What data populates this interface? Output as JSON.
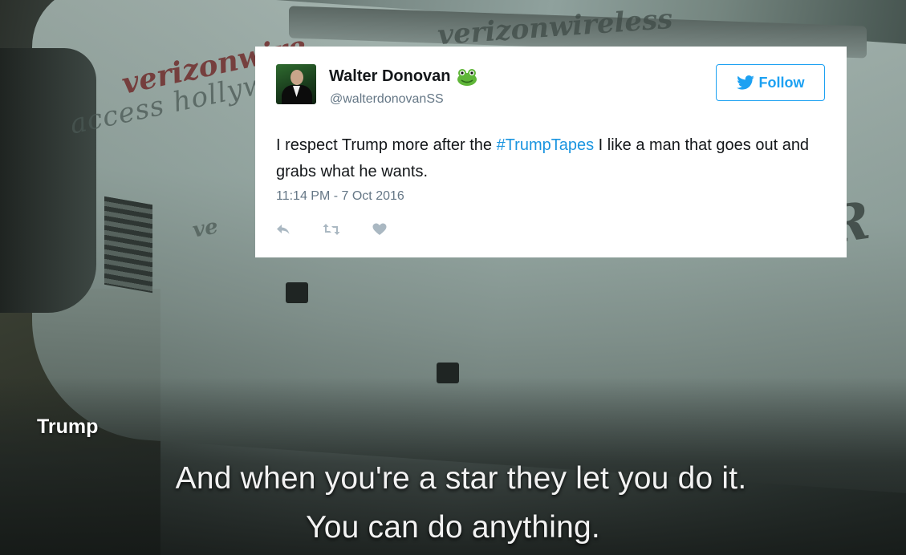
{
  "video": {
    "scene_texts": [
      "verizonwire",
      "access hollyw",
      "verizonwireless",
      "UR",
      "ve"
    ],
    "speaker": "Trump",
    "caption_line_1": "And when you're a star they let you do it.",
    "caption_line_2": "You can do anything."
  },
  "tweet": {
    "author_name": "Walter Donovan",
    "author_handle": "@walterdonovanSS",
    "follow_label": "Follow",
    "text_before": "I respect Trump more after the ",
    "hashtag": "#TrumpTapes",
    "text_after": " I like a man that goes out and grabs what he wants.",
    "timestamp": "11:14 PM - 7 Oct 2016",
    "icons": [
      "frog-emoji-icon",
      "twitter-bird-icon",
      "reply-icon",
      "retweet-icon",
      "like-heart-icon"
    ]
  },
  "colors": {
    "twitter_blue": "#1da1f2",
    "hashtag_blue": "#1b95e0",
    "secondary_text": "#657786",
    "action_icon": "#aab8c2"
  }
}
